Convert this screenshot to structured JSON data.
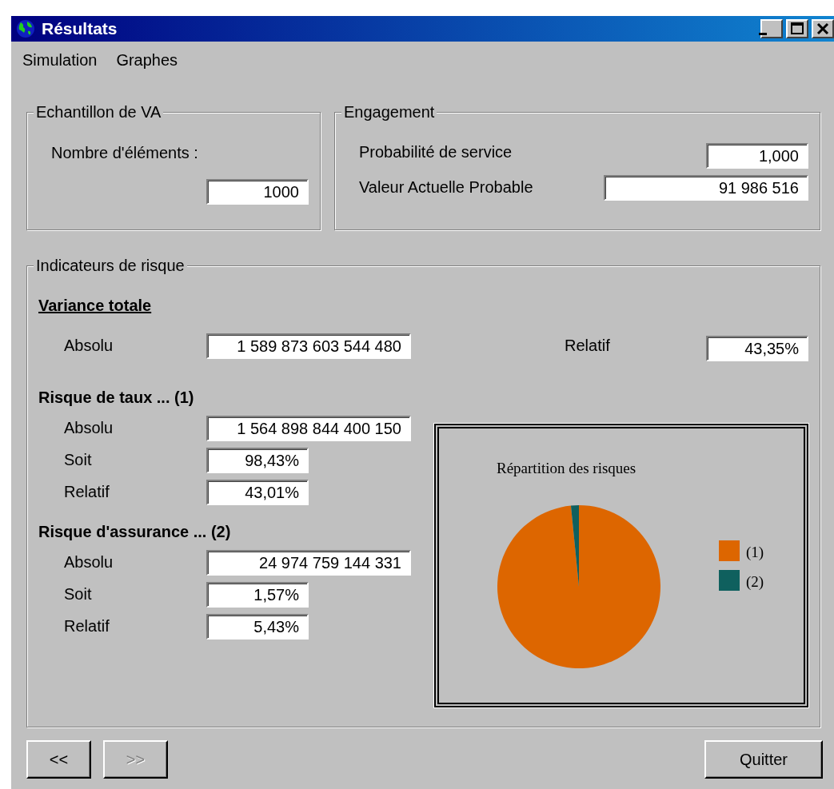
{
  "window": {
    "title": "Résultats"
  },
  "menu": [
    {
      "label": "Simulation"
    },
    {
      "label": "Graphes"
    }
  ],
  "echantillon": {
    "title": "Echantillon de VA",
    "label": "Nombre d'éléments :",
    "value": "1000"
  },
  "engagement": {
    "title": "Engagement",
    "fields": [
      {
        "label": "Probabilité de service",
        "value": "1,000"
      },
      {
        "label": "Valeur Actuelle Probable",
        "value": "91 986 516"
      }
    ]
  },
  "indicateurs": {
    "title": "Indicateurs de risque",
    "variance": {
      "heading": "Variance totale",
      "absolu_label": "Absolu",
      "absolu": "1 589 873 603 544 480",
      "relatif_label": "Relatif",
      "relatif": "43,35%"
    },
    "sections": [
      {
        "heading": "Risque de taux ... (1)",
        "rows": [
          {
            "label": "Absolu",
            "value": "1 564 898 844 400 150",
            "kind": "wide"
          },
          {
            "label": "Soit",
            "value": "98,43%",
            "kind": "narrow"
          },
          {
            "label": "Relatif",
            "value": "43,01%",
            "kind": "narrow"
          }
        ]
      },
      {
        "heading": "Risque d'assurance ... (2)",
        "rows": [
          {
            "label": "Absolu",
            "value": "24 974 759 144 331",
            "kind": "wide"
          },
          {
            "label": "Soit",
            "value": "1,57%",
            "kind": "narrow"
          },
          {
            "label": "Relatif",
            "value": "5,43%",
            "kind": "narrow"
          }
        ]
      }
    ],
    "chart": {
      "chart_data": {
        "type": "pie",
        "title": "Répartition des risques",
        "categories": [
          "(1)",
          "(2)"
        ],
        "values": [
          98.43,
          1.57
        ],
        "legend": "right",
        "colors": [
          "#dd6600",
          "#0f605e"
        ]
      }
    }
  },
  "nav_buttons": [
    {
      "label": "<<",
      "disabled": false
    },
    {
      "label": ">>",
      "disabled": true
    }
  ],
  "quit_button": {
    "label": "Quitter"
  }
}
